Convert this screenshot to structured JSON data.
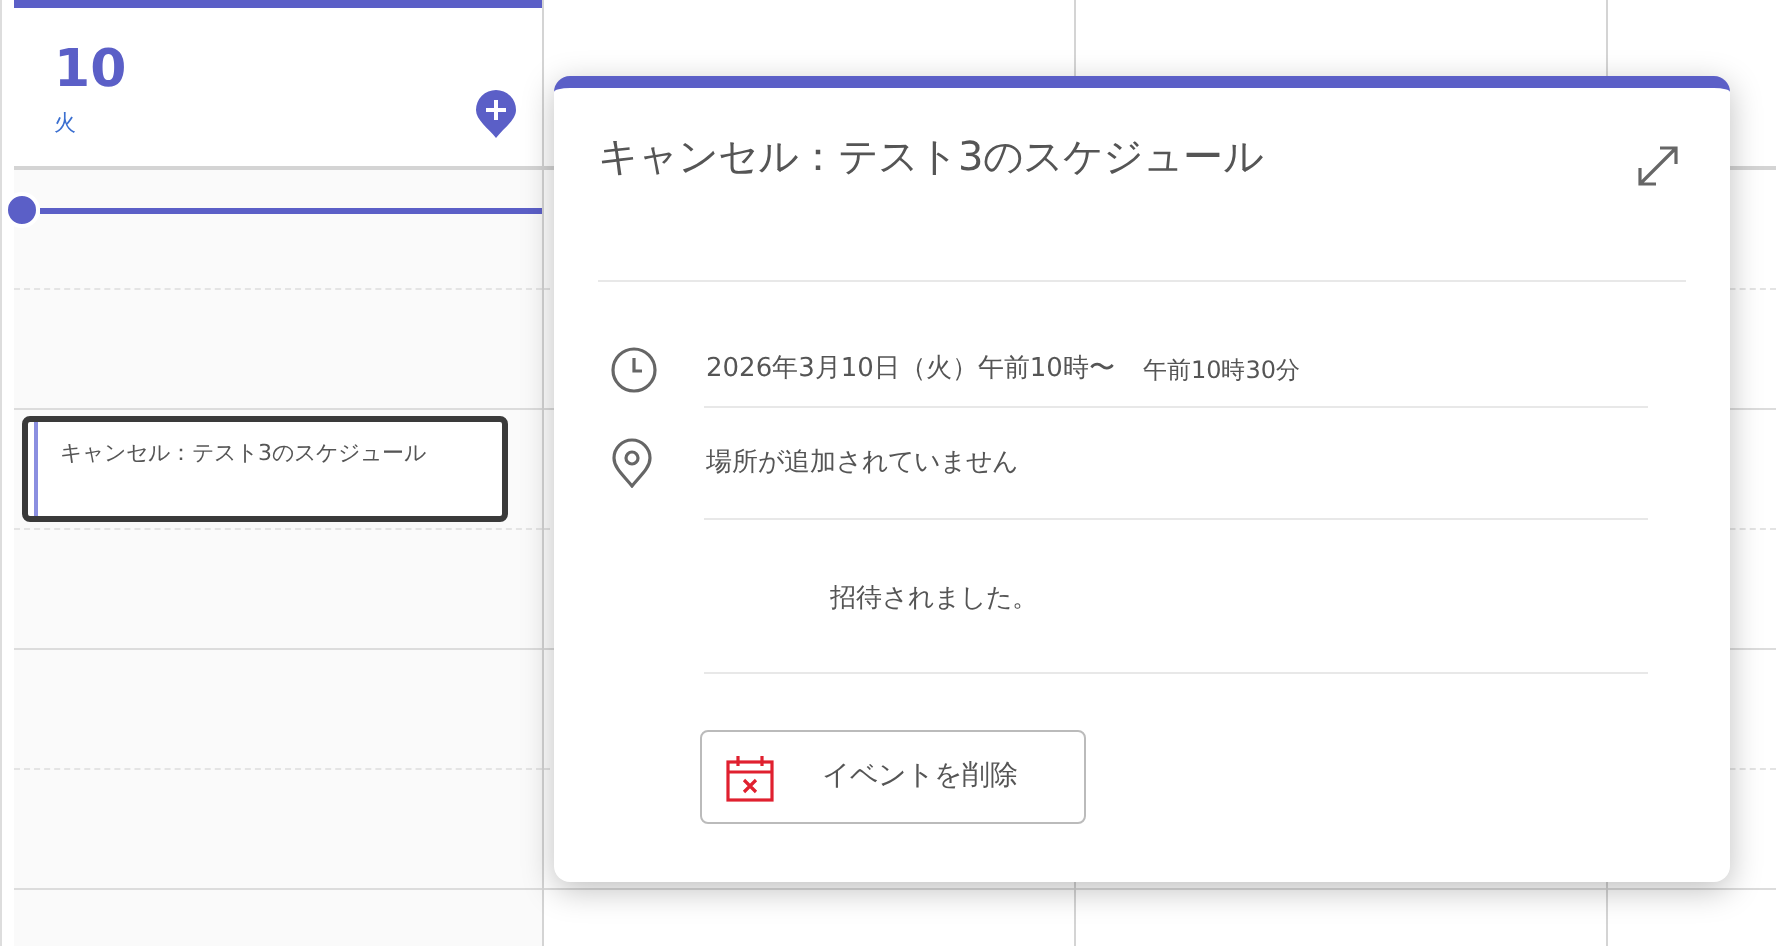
{
  "days": [
    {
      "date": "10",
      "weekday": "火",
      "selected": true,
      "events": [
        {
          "title": "キャンセル：テスト3のスケジュール",
          "focused": true
        }
      ]
    },
    {
      "selected": false
    },
    {
      "selected": false
    },
    {
      "selected": false
    }
  ],
  "popup": {
    "title": "キャンセル：テスト3のスケジュール",
    "time_start": "2026年3月10日（火）午前10時〜",
    "time_end": "午前10時30分",
    "location": "場所が追加されていません",
    "description": "招待されました。",
    "delete_button": "イベントを削除"
  }
}
